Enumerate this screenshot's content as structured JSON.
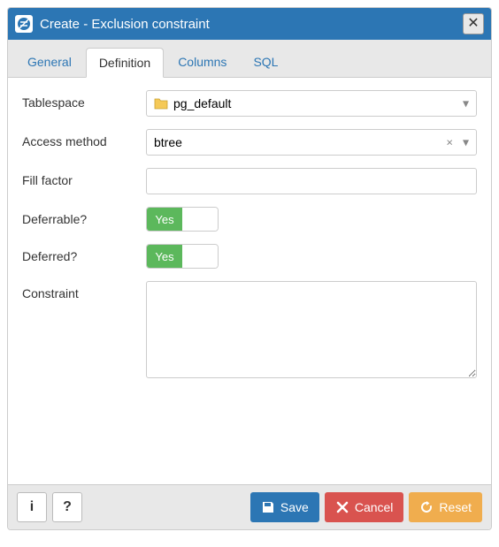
{
  "dialog": {
    "title": "Create - Exclusion constraint"
  },
  "tabs": {
    "general": "General",
    "definition": "Definition",
    "columns": "Columns",
    "sql": "SQL"
  },
  "form": {
    "tablespace": {
      "label": "Tablespace",
      "value": "pg_default"
    },
    "access_method": {
      "label": "Access method",
      "value": "btree"
    },
    "fill_factor": {
      "label": "Fill factor",
      "value": ""
    },
    "deferrable": {
      "label": "Deferrable?",
      "value": "Yes"
    },
    "deferred": {
      "label": "Deferred?",
      "value": "Yes"
    },
    "constraint": {
      "label": "Constraint",
      "value": ""
    }
  },
  "footer": {
    "save": "Save",
    "cancel": "Cancel",
    "reset": "Reset"
  }
}
